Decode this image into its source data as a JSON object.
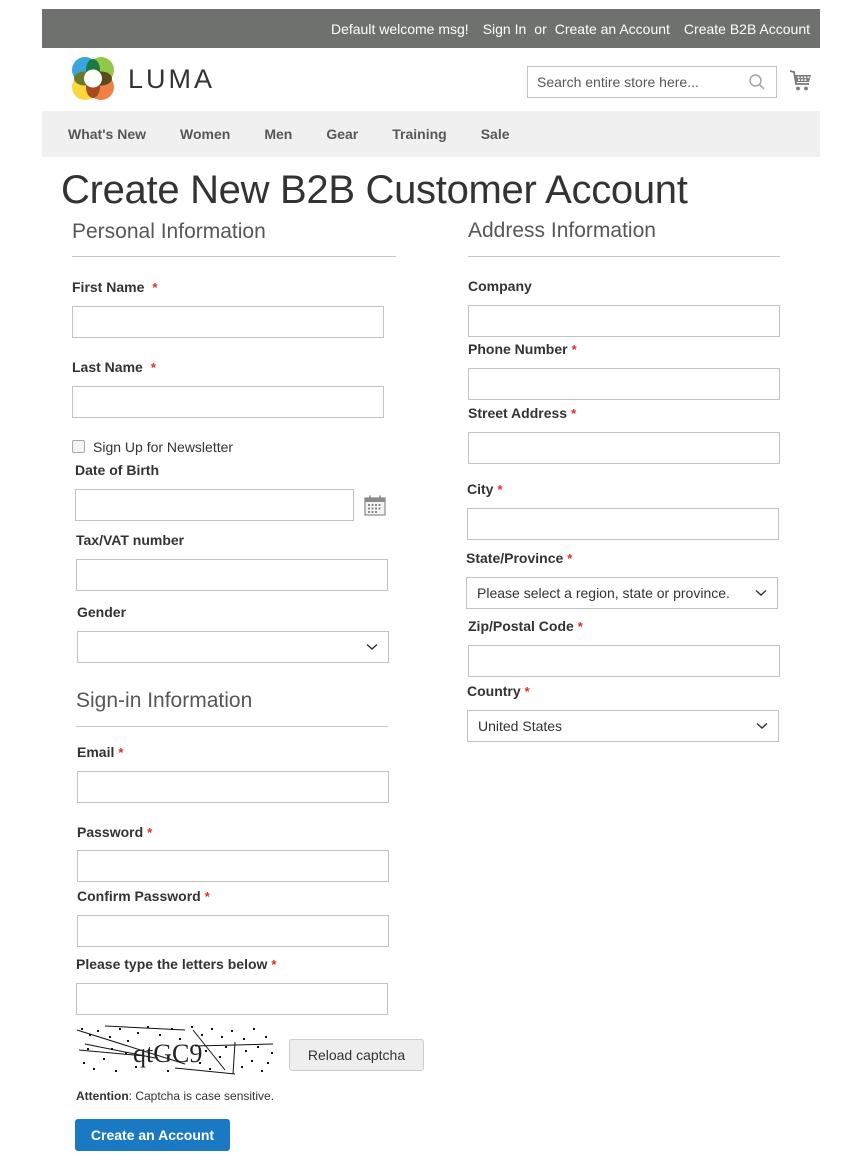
{
  "topbar": {
    "welcome": "Default welcome msg!",
    "sign_in": "Sign In",
    "or": "or",
    "create_account": "Create an Account",
    "create_b2b_account": "Create B2B Account"
  },
  "header": {
    "logo_text": "LUMA",
    "logo_icon": "luma-logo-icon",
    "search_placeholder": "Search entire store here...",
    "search_icon": "search-icon",
    "cart_icon": "cart-icon"
  },
  "nav": {
    "items": [
      "What's New",
      "Women",
      "Men",
      "Gear",
      "Training",
      "Sale"
    ]
  },
  "page_title": "Create New B2B Customer Account",
  "personal": {
    "title": "Personal Information",
    "first_name": {
      "label": "First Name",
      "required": "*",
      "value": ""
    },
    "last_name": {
      "label": "Last Name",
      "required": "*",
      "value": ""
    },
    "newsletter": {
      "label": "Sign Up for Newsletter",
      "checked": false
    },
    "dob": {
      "label": "Date of Birth",
      "value": "",
      "icon": "calendar-icon"
    },
    "taxvat": {
      "label": "Tax/VAT number",
      "value": ""
    },
    "gender": {
      "label": "Gender",
      "selected": ""
    }
  },
  "signin": {
    "title": "Sign-in Information",
    "email": {
      "label": "Email",
      "required": "*",
      "value": ""
    },
    "password": {
      "label": "Password",
      "required": "*",
      "value": ""
    },
    "confirm_password": {
      "label": "Confirm Password",
      "required": "*",
      "value": ""
    },
    "captcha": {
      "label": "Please type the letters below",
      "required": "*",
      "value": "",
      "image_text": "qtGC9"
    },
    "reload_captcha": "Reload captcha",
    "attention_label": "Attention",
    "attention_text": ": Captcha is case sensitive.",
    "submit": "Create an Account"
  },
  "address": {
    "title": "Address Information",
    "company": {
      "label": "Company",
      "value": ""
    },
    "phone": {
      "label": "Phone Number",
      "required": "*",
      "value": ""
    },
    "street": {
      "label": "Street Address",
      "required": "*",
      "value": ""
    },
    "city": {
      "label": "City",
      "required": "*",
      "value": ""
    },
    "region": {
      "label": "State/Province",
      "required": "*",
      "selected": "Please select a region, state or province."
    },
    "zip": {
      "label": "Zip/Postal Code",
      "required": "*",
      "value": ""
    },
    "country": {
      "label": "Country",
      "required": "*",
      "selected": "United States"
    }
  },
  "colors": {
    "topbar_bg": "#6e716e",
    "nav_bg": "#f0f0f0",
    "required": "#e02b27",
    "primary": "#1979c3"
  }
}
